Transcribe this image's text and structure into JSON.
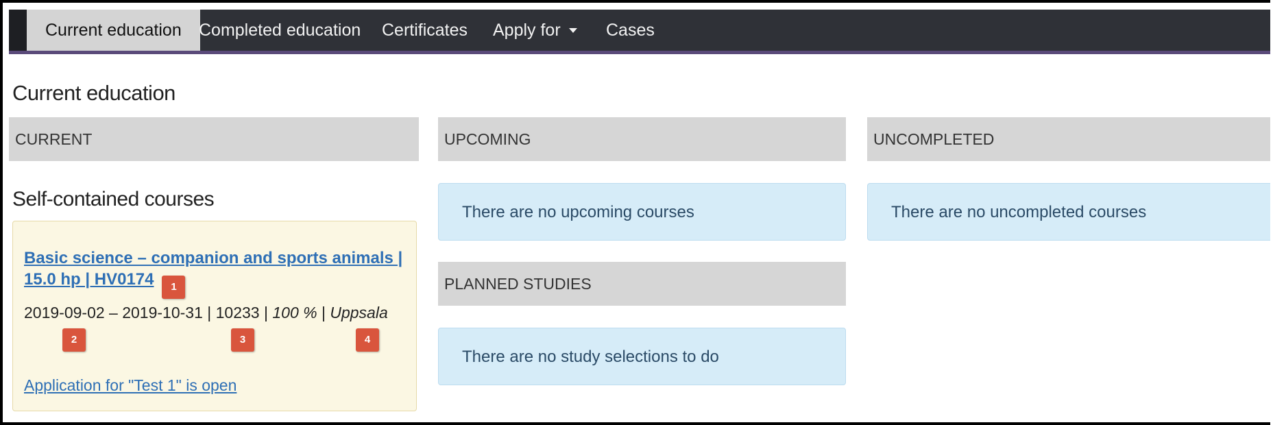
{
  "nav": {
    "items": [
      {
        "label": "Current education"
      },
      {
        "label": "Completed education"
      },
      {
        "label": "Certificates"
      },
      {
        "label": "Apply for"
      },
      {
        "label": "Cases"
      }
    ]
  },
  "page": {
    "title": "Current education"
  },
  "columns": {
    "current": "CURRENT",
    "upcoming": "UPCOMING",
    "uncompleted": "UNCOMPLETED",
    "planned": "PLANNED STUDIES"
  },
  "current": {
    "section_title": "Self-contained courses",
    "course": {
      "link": "Basic science – companion and sports animals | 15.0 hp | HV0174",
      "dates": "2019-09-02 – 2019-10-31",
      "code": "10233",
      "pace": "100 %",
      "location": "Uppsala",
      "separator": " | "
    },
    "application_link": "Application for \"Test 1\" is open"
  },
  "badges": [
    "1",
    "2",
    "3",
    "4"
  ],
  "messages": {
    "no_upcoming": "There are no upcoming courses",
    "no_uncompleted": "There are no uncompleted courses",
    "no_study_selections": "There are no study selections to do"
  }
}
